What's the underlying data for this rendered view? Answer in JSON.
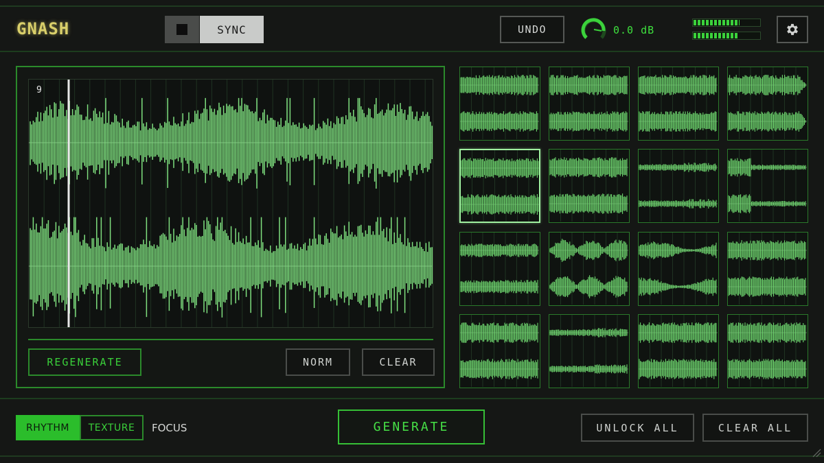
{
  "app": {
    "logo": "GNASH"
  },
  "header": {
    "sync_label": "SYNC",
    "undo_label": "UNDO",
    "gain_value": "0.0 dB",
    "gain_level": 0.75,
    "meters": [
      0.68,
      0.66
    ]
  },
  "editor": {
    "slice_number": "9",
    "regenerate_label": "REGENERATE",
    "norm_label": "NORM",
    "clear_label": "CLEAR"
  },
  "slots": {
    "count": 16,
    "selected_index": 4
  },
  "footer": {
    "rhythm_label": "RHYTHM",
    "texture_label": "TEXTURE",
    "focus_label": "FOCUS",
    "active_mode": "RHYTHM",
    "generate_label": "GENERATE",
    "unlock_all_label": "UNLOCK ALL",
    "clear_all_label": "CLEAR ALL"
  },
  "colors": {
    "accent": "#3bd23b",
    "waveform": "#7fe07f",
    "logo": "#d9cf6a"
  },
  "icons": [
    "stop-icon",
    "gain-knob-icon",
    "gear-icon",
    "resize-grip-icon"
  ]
}
